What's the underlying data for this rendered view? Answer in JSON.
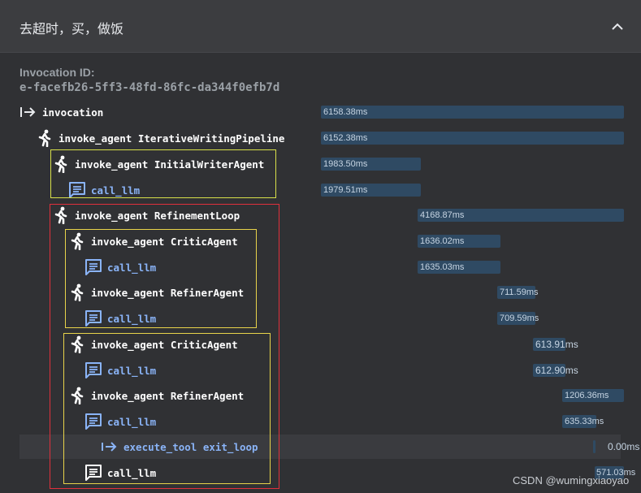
{
  "header": {
    "title": "去超时，买，做饭"
  },
  "invocation": {
    "label": "Invocation ID:",
    "id": "e-facefb26-5ff3-48fd-86fc-da344f0efb7d"
  },
  "spans": [
    {
      "label": "invocation",
      "icon": "arrow-enter-icon",
      "duration": "6158.38ms"
    },
    {
      "label": "invoke_agent IterativeWritingPipeline",
      "icon": "running-person-icon",
      "duration": "6152.38ms"
    },
    {
      "label": "invoke_agent InitialWriterAgent",
      "icon": "running-person-icon",
      "duration": "1983.50ms"
    },
    {
      "label": "call_llm",
      "icon": "message-icon",
      "duration": "1979.51ms"
    },
    {
      "label": "invoke_agent RefinementLoop",
      "icon": "running-person-icon",
      "duration": "4168.87ms"
    },
    {
      "label": "invoke_agent CriticAgent",
      "icon": "running-person-icon",
      "duration": "1636.02ms"
    },
    {
      "label": "call_llm",
      "icon": "message-icon",
      "duration": "1635.03ms"
    },
    {
      "label": "invoke_agent RefinerAgent",
      "icon": "running-person-icon",
      "duration": "711.59ms"
    },
    {
      "label": "call_llm",
      "icon": "message-icon",
      "duration": "709.59ms"
    },
    {
      "label": "invoke_agent CriticAgent",
      "icon": "running-person-icon",
      "duration": "613.91ms"
    },
    {
      "label": "call_llm",
      "icon": "message-icon",
      "duration": "612.90ms"
    },
    {
      "label": "invoke_agent RefinerAgent",
      "icon": "running-person-icon",
      "duration": "1206.36ms"
    },
    {
      "label": "call_llm",
      "icon": "message-icon",
      "duration": "635.33ms"
    },
    {
      "label": "execute_tool exit_loop",
      "icon": "arrow-enter-icon",
      "duration": "0.00ms"
    },
    {
      "label": "call_llm",
      "icon": "message-icon",
      "duration": "571.03ms"
    }
  ],
  "watermark": "CSDN @wumingxiaoyao",
  "colors": {
    "bar": "#2f4a63",
    "llm_text": "#8ab4f8",
    "red_box": "#e0303c",
    "yellow_box": "#e8d34a"
  }
}
